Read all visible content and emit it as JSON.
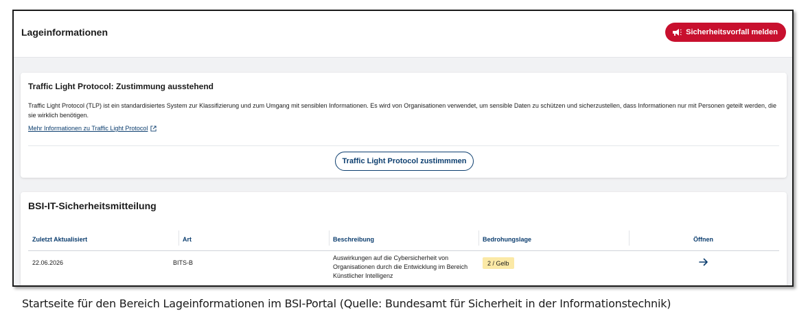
{
  "header": {
    "title": "Lageinformationen",
    "report_button": "Sicherheitsvorfall melden"
  },
  "tlp": {
    "title": "Traffic Light Protocol: Zustimmung ausstehend",
    "description": "Traffic Light Protocol (TLP) ist ein standardisiertes System zur Klassifizierung und zum Umgang mit sensiblen Informationen. Es wird von Organisationen verwendet, um sensible Daten zu schützen und sicherzustellen, dass Informationen nur mit Personen geteilt werden, die sie wirklich benötigen.",
    "link": "Mehr Informationen zu Traffic Light Protocol",
    "consent_button": "Traffic Light Protocol zustimmmen"
  },
  "bsi": {
    "title": "BSI-IT-Sicherheitsmitteilung",
    "columns": [
      "Zuletzt Aktualisiert",
      "Art",
      "Beschreibung",
      "Bedrohungslage",
      "Öffnen"
    ],
    "rows": [
      {
        "date": "22.06.2026",
        "type": "BITS-B",
        "description": "Auswirkungen auf die Cybersicherheit von Organisationen durch die Entwicklung im Bereich Künstlicher Intelligenz",
        "threat": "2 / Gelb"
      }
    ]
  },
  "caption": "Startseite für den Bereich Lageinformationen im BSI-Portal (Quelle: Bundesamt für Sicherheit in der Informationstechnik)",
  "colors": {
    "brand_red": "#c8102e",
    "link_blue": "#0b3d6e",
    "badge_yellow": "#fbe9a6"
  }
}
